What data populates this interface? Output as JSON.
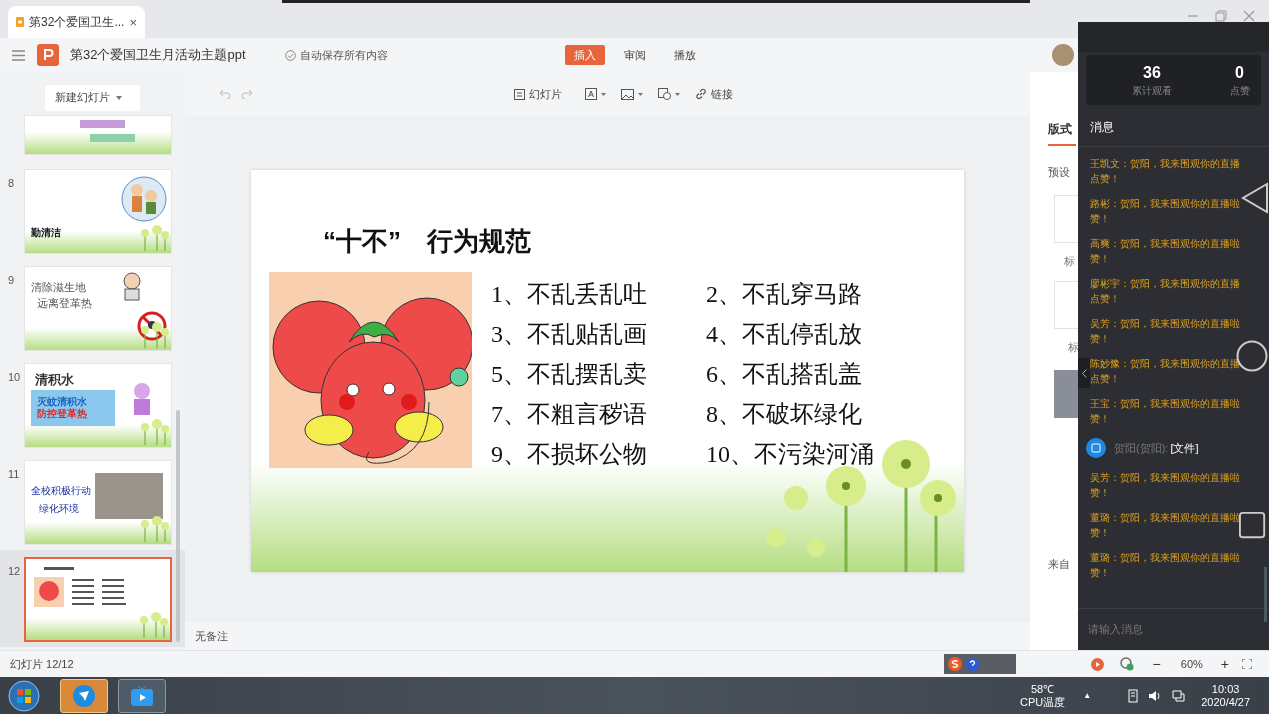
{
  "browser_tab": {
    "title": "第32个爱国卫生...",
    "close": "×"
  },
  "header": {
    "title": "第32个爱国卫生月活动主题ppt",
    "autosave": "自动保存所有内容",
    "tabs": [
      {
        "label": "插入",
        "selected": true
      },
      {
        "label": "审阅",
        "selected": false
      },
      {
        "label": "播放",
        "selected": false
      }
    ]
  },
  "toolbar": {
    "new_slide": "新建幻灯片",
    "slide": "幻灯片",
    "link": "链接"
  },
  "thumbnails": [
    {
      "kind": "partial",
      "selected": false
    },
    {
      "kind": "cartoon",
      "number": "8",
      "selected": false,
      "lines": [
        "勤清洁"
      ]
    },
    {
      "kind": "mosquito",
      "number": "9",
      "selected": false,
      "lines": [
        "清除滋生地",
        "远离登革热"
      ]
    },
    {
      "kind": "water",
      "number": "10",
      "selected": false,
      "lines": [
        "清积水",
        "灭蚊清积水",
        "防控登革热"
      ]
    },
    {
      "kind": "photo",
      "number": "11",
      "selected": false,
      "lines": [
        "全校积极行动",
        "绿化环境"
      ]
    },
    {
      "kind": "rules",
      "number": "12",
      "selected": true
    }
  ],
  "slide": {
    "title": "“十不”　行为规范",
    "items": [
      "1、不乱丢乱吐",
      "2、不乱穿马路",
      "3、不乱贴乱画",
      "4、不乱停乱放",
      "5、不乱摆乱卖",
      "6、不乱搭乱盖",
      "7、不粗言秽语",
      "8、不破坏绿化",
      "9、不损坏公物",
      "10、不污染河涌"
    ]
  },
  "notes": "无备注",
  "right_pane": {
    "tabs": [
      {
        "label": "版式",
        "selected": true
      }
    ],
    "section": "预设",
    "captions": [
      "标",
      "标"
    ],
    "footer": "来自"
  },
  "live_panel": {
    "stats": [
      {
        "value": "36",
        "label": "累计观看"
      },
      {
        "value": "0",
        "label": "点赞"
      }
    ],
    "title": "消息",
    "messages": [
      {
        "kind": "comment",
        "lines": [
          "王凯文：贺阳，我来围观你的直播",
          "点赞！"
        ]
      },
      {
        "kind": "comment",
        "lines": [
          "路彬：贺阳，我来围观你的直播啦",
          "赞！"
        ]
      },
      {
        "kind": "comment",
        "lines": [
          "高爽：贺阳，我来围观你的直播啦",
          "赞！"
        ]
      },
      {
        "kind": "comment",
        "lines": [
          "廖彬宇：贺阳，我来围观你的直播",
          "点赞！"
        ]
      },
      {
        "kind": "comment",
        "lines": [
          "吴芳：贺阳，我来围观你的直播啦",
          "赞！"
        ]
      },
      {
        "kind": "comment",
        "lines": [
          "陈妙豫：贺阳，我来围观你的直播",
          "点赞！"
        ]
      },
      {
        "kind": "comment",
        "lines": [
          "王宝：贺阳，我来围观你的直播啦",
          "赞！"
        ]
      },
      {
        "kind": "file",
        "sender": "贺阳(贺阳):",
        "text": "[文件]"
      },
      {
        "kind": "comment",
        "lines": [
          "吴芳：贺阳，我来围观你的直播啦",
          "赞！"
        ]
      },
      {
        "kind": "comment",
        "lines": [
          "董璐：贺阳，我来围观你的直播啦",
          "赞！"
        ]
      },
      {
        "kind": "comment",
        "lines": [
          "董璐：贺阳，我来围观你的直播啦",
          "赞！"
        ]
      }
    ],
    "input": {
      "placeholder": "请输入消息"
    }
  },
  "status_bar": {
    "slide_count": "幻灯片 12/12",
    "zoom_out": "−",
    "zoom": "60%",
    "zoom_in": "+"
  },
  "taskbar": {
    "temperature": "58℃",
    "temperature_label": "CPU温度",
    "tray_arrow": "▲",
    "time": "10:03",
    "date": "2020/4/27"
  }
}
